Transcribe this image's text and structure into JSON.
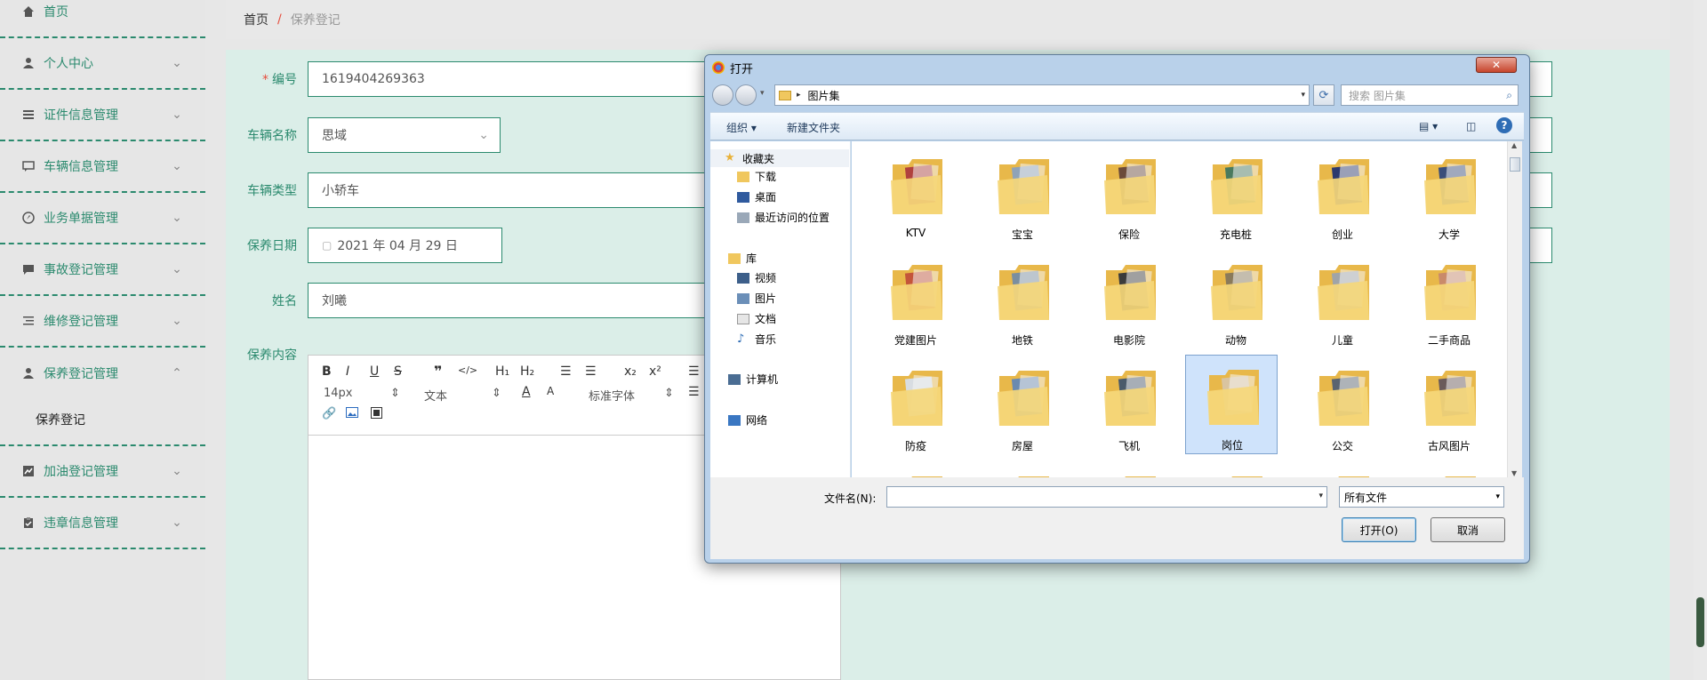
{
  "sidebar": {
    "items": [
      {
        "label": "首页",
        "icon": "home-icon"
      },
      {
        "label": "个人中心",
        "icon": "user-icon"
      },
      {
        "label": "证件信息管理",
        "icon": "list-icon"
      },
      {
        "label": "车辆信息管理",
        "icon": "chat-icon"
      },
      {
        "label": "业务单据管理",
        "icon": "compass-icon"
      },
      {
        "label": "事故登记管理",
        "icon": "message-icon"
      },
      {
        "label": "维修登记管理",
        "icon": "list-icon"
      },
      {
        "label": "保养登记管理",
        "icon": "user-icon"
      },
      {
        "label": "加油登记管理",
        "icon": "chart-icon"
      },
      {
        "label": "违章信息管理",
        "icon": "clipboard-icon"
      }
    ],
    "sub_item": "保养登记"
  },
  "breadcrumb": {
    "home": "首页",
    "sep": "/",
    "current": "保养登记"
  },
  "form": {
    "code_label": "编号",
    "code_value": "1619404269363",
    "car_name_label": "车辆名称",
    "car_name_value": "思域",
    "car_type_label": "车辆类型",
    "car_type_value": "小轿车",
    "date_label": "保养日期",
    "date_value": "2021 年 04 月 29 日",
    "name_label": "姓名",
    "name_value": "刘曦",
    "content_label": "保养内容"
  },
  "editor": {
    "font_size": "14px",
    "text_type": "文本",
    "font_family": "标准字体"
  },
  "dialog": {
    "title": "打开",
    "close": "✕",
    "address": "图片集",
    "search_placeholder": "搜索 图片集",
    "cmd_organize": "组织",
    "cmd_new_folder": "新建文件夹",
    "tree": {
      "favorites": "收藏夹",
      "downloads": "下载",
      "desktop": "桌面",
      "recent": "最近访问的位置",
      "libraries": "库",
      "videos": "视频",
      "pictures": "图片",
      "documents": "文档",
      "music": "音乐",
      "computer": "计算机",
      "network": "网络"
    },
    "folders": [
      "KTV",
      "宝宝",
      "保险",
      "充电桩",
      "创业",
      "大学",
      "党建图片",
      "地铁",
      "电影院",
      "动物",
      "儿童",
      "二手商品",
      "防疫",
      "房屋",
      "飞机",
      "岗位",
      "公交",
      "古风图片"
    ],
    "filename_label": "文件名(N):",
    "filename_value": "",
    "filter": "所有文件",
    "open_button": "打开(O)",
    "cancel_button": "取消"
  },
  "colors": {
    "accent": "#2b8a6e",
    "panel": "#dbeee8"
  }
}
